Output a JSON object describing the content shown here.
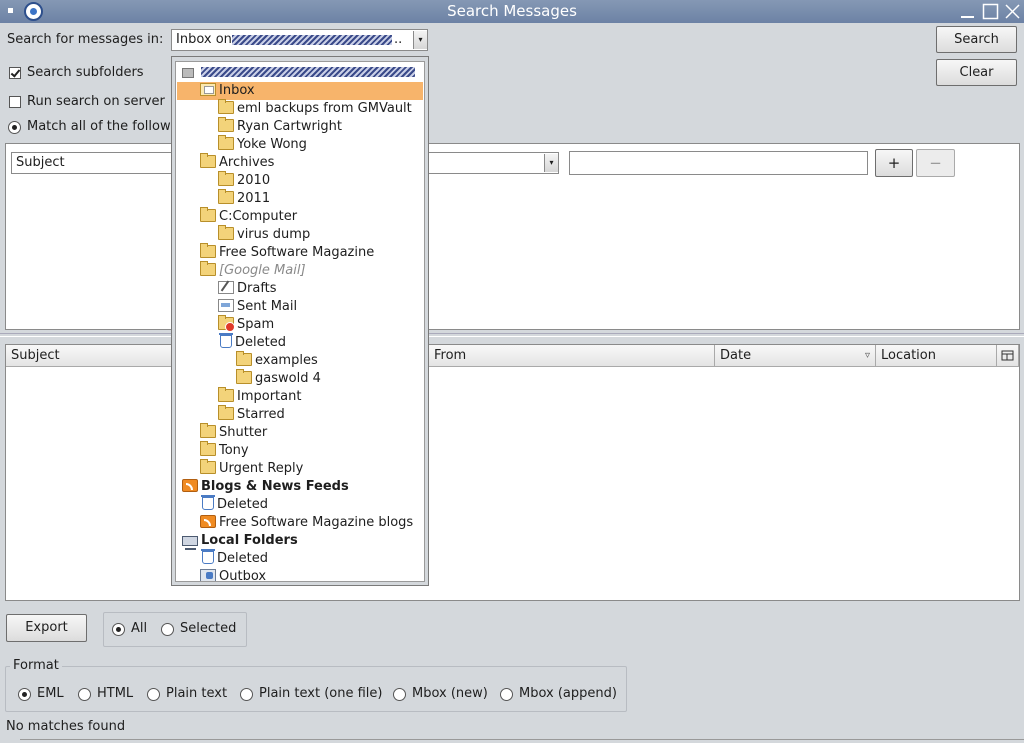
{
  "window": {
    "title": "Search Messages"
  },
  "search": {
    "label": "Search for messages in:",
    "selected_folder": "Inbox on",
    "search_button": "Search",
    "clear_button": "Clear",
    "search_subfolders_label": "Search subfolders",
    "search_subfolders_checked": true,
    "run_on_server_label": "Run search on server",
    "run_on_server_checked": false,
    "match_label": "Match all of the followin"
  },
  "rule": {
    "field": "Subject",
    "add_button": "+",
    "remove_button": "−"
  },
  "results": {
    "columns": [
      "Subject",
      "From",
      "Date",
      "Location"
    ]
  },
  "export": {
    "button": "Export",
    "scope_options": [
      "All",
      "Selected"
    ],
    "scope_selected": "All"
  },
  "format": {
    "legend": "Format",
    "options": [
      "EML",
      "HTML",
      "Plain text",
      "Plain text (one file)",
      "Mbox (new)",
      "Mbox (append)"
    ],
    "selected": "EML"
  },
  "status": {
    "text": "No matches found"
  },
  "folder_menu": {
    "items": [
      {
        "label": "Inbox",
        "icon": "inbox-icon",
        "level": 1,
        "style": "highlighted"
      },
      {
        "label": "eml backups from GMVault",
        "icon": "folder-icon",
        "level": 2
      },
      {
        "label": "Ryan Cartwright",
        "icon": "folder-icon",
        "level": 2
      },
      {
        "label": "Yoke Wong",
        "icon": "folder-icon",
        "level": 2
      },
      {
        "label": "Archives",
        "icon": "folder-icon",
        "level": 1
      },
      {
        "label": "2010",
        "icon": "folder-icon",
        "level": 2
      },
      {
        "label": "2011",
        "icon": "folder-icon",
        "level": 2
      },
      {
        "label": "C:Computer",
        "icon": "folder-icon",
        "level": 1
      },
      {
        "label": "virus dump",
        "icon": "folder-icon",
        "level": 2
      },
      {
        "label": "Free Software Magazine",
        "icon": "folder-icon",
        "level": 1
      },
      {
        "label": "[Google Mail]",
        "icon": "folder-icon",
        "level": 1,
        "style": "italic"
      },
      {
        "label": "Drafts",
        "icon": "drafts-icon",
        "level": 2
      },
      {
        "label": "Sent Mail",
        "icon": "sent-icon",
        "level": 2
      },
      {
        "label": "Spam",
        "icon": "spam-icon",
        "level": 2
      },
      {
        "label": "Deleted",
        "icon": "trash-icon",
        "level": 2
      },
      {
        "label": "examples",
        "icon": "folder-icon",
        "level": 3
      },
      {
        "label": "gaswold 4",
        "icon": "folder-icon",
        "level": 3
      },
      {
        "label": "Important",
        "icon": "folder-icon",
        "level": 2
      },
      {
        "label": "Starred",
        "icon": "folder-icon",
        "level": 2
      },
      {
        "label": "Shutter",
        "icon": "folder-icon",
        "level": 1
      },
      {
        "label": "Tony",
        "icon": "folder-icon",
        "level": 1
      },
      {
        "label": "Urgent Reply",
        "icon": "folder-icon",
        "level": 1
      },
      {
        "label": "Blogs & News Feeds",
        "icon": "rss-icon",
        "level": 0,
        "style": "bold"
      },
      {
        "label": "Deleted",
        "icon": "trash-icon",
        "level": 1
      },
      {
        "label": "Free Software Magazine blogs",
        "icon": "rss-icon",
        "level": 1
      },
      {
        "label": "Local Folders",
        "icon": "computer-icon",
        "level": 0,
        "style": "bold"
      },
      {
        "label": "Deleted",
        "icon": "trash-icon",
        "level": 1
      },
      {
        "label": "Outbox",
        "icon": "outbox-icon",
        "level": 1
      }
    ]
  }
}
